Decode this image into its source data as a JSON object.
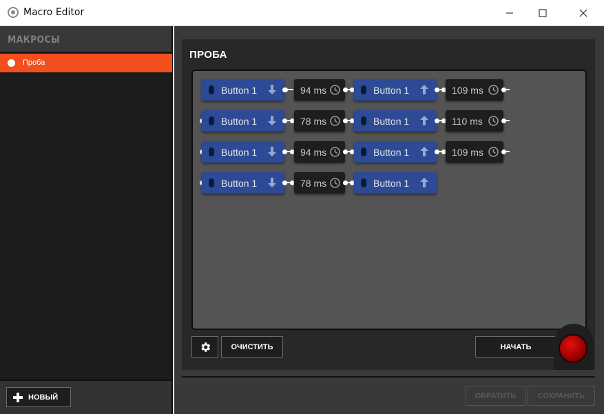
{
  "window": {
    "title": "Macro Editor"
  },
  "sidebar": {
    "header": "МАКРОСЫ",
    "items": [
      {
        "label": "Проба",
        "selected": true
      }
    ],
    "new_button": "НОВЫЙ"
  },
  "editor": {
    "macro_title": "ПРОБА",
    "rows": [
      {
        "press": "Button 1",
        "delay1": "94 ms",
        "release": "Button 1",
        "delay2": "109 ms"
      },
      {
        "press": "Button 1",
        "delay1": "78 ms",
        "release": "Button 1",
        "delay2": "110 ms"
      },
      {
        "press": "Button 1",
        "delay1": "94 ms",
        "release": "Button 1",
        "delay2": "109 ms"
      },
      {
        "press": "Button 1",
        "delay1": "78 ms",
        "release": "Button 1"
      }
    ],
    "clear_button": "ОЧИСТИТЬ",
    "start_button": "НАЧАТЬ",
    "revert_button": "ОБРАТИТЬ",
    "save_button": "СОХРАНИТЬ"
  },
  "colors": {
    "accent": "#f24e1e",
    "button_node": "#2c4a95",
    "delay_node": "#1e1e1e",
    "record": "#cc0000"
  }
}
